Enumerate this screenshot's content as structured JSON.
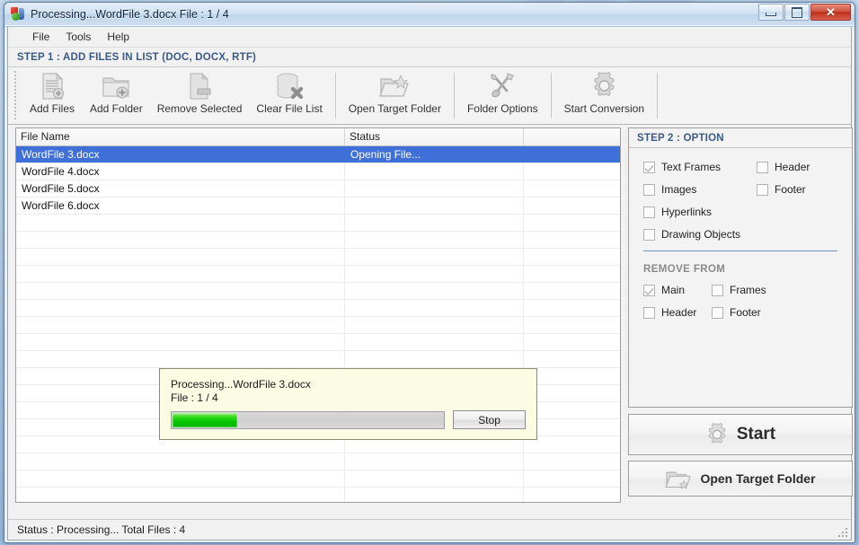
{
  "window": {
    "title": "Processing...WordFile 3.docx File : 1 / 4",
    "icon": "app-icon",
    "caption_buttons": [
      {
        "name": "minimize",
        "glyph": "minimize-icon"
      },
      {
        "name": "maximize",
        "glyph": "maximize-icon"
      },
      {
        "name": "close",
        "glyph": "✕"
      }
    ]
  },
  "menubar": {
    "items": [
      {
        "label": "File"
      },
      {
        "label": "Tools"
      },
      {
        "label": "Help"
      }
    ]
  },
  "step1": {
    "header": "STEP 1 : ADD FILES IN LIST (DOC, DOCX, RTF)",
    "toolbar": [
      {
        "label": "Add Files",
        "icon": "add-files-icon"
      },
      {
        "label": "Add Folder",
        "icon": "add-folder-icon"
      },
      {
        "label": "Remove Selected",
        "icon": "remove-selected-icon"
      },
      {
        "label": "Clear File List",
        "icon": "clear-file-list-icon"
      },
      {
        "label": "Open Target Folder",
        "icon": "open-target-folder-icon"
      },
      {
        "label": "Folder Options",
        "icon": "folder-options-icon"
      },
      {
        "label": "Start Conversion",
        "icon": "start-conversion-icon"
      }
    ]
  },
  "filelist": {
    "columns": [
      "File Name",
      "Status",
      ""
    ],
    "rows": [
      {
        "file_name": "WordFile 3.docx",
        "status": "Opening File...",
        "extra": "",
        "selected": true
      },
      {
        "file_name": "WordFile 4.docx",
        "status": "",
        "extra": "",
        "selected": false
      },
      {
        "file_name": "WordFile 5.docx",
        "status": "",
        "extra": "",
        "selected": false
      },
      {
        "file_name": "WordFile 6.docx",
        "status": "",
        "extra": "",
        "selected": false
      }
    ],
    "empty_rows": 17,
    "selection_color": "#3f6fd8"
  },
  "progress_dialog": {
    "line1": "Processing...WordFile 3.docx",
    "line2": "File : 1 / 4",
    "progress_percent": 24,
    "progress_color": "#06c000",
    "background_color": "#fcfbe3",
    "stop_label": "Stop"
  },
  "step2": {
    "header": "STEP 2 : OPTION",
    "options": [
      {
        "label": "Text Frames",
        "checked": true
      },
      {
        "label": "Header",
        "checked": false
      },
      {
        "label": "Images",
        "checked": false
      },
      {
        "label": "Footer",
        "checked": false
      },
      {
        "label": "Hyperlinks",
        "checked": false
      },
      {
        "label": "Drawing Objects",
        "checked": false
      }
    ],
    "remove_from_label": "REMOVE FROM",
    "remove_from": [
      {
        "label": "Main",
        "checked": true
      },
      {
        "label": "Frames",
        "checked": false
      },
      {
        "label": "Header",
        "checked": false
      },
      {
        "label": "Footer",
        "checked": false
      }
    ],
    "start_button": {
      "label": "Start",
      "icon": "gear-icon"
    },
    "open_target_button": {
      "label": "Open Target Folder",
      "icon": "open-folder-icon"
    }
  },
  "statusbar": {
    "text": "Status  :  Processing...  Total Files : 4"
  }
}
